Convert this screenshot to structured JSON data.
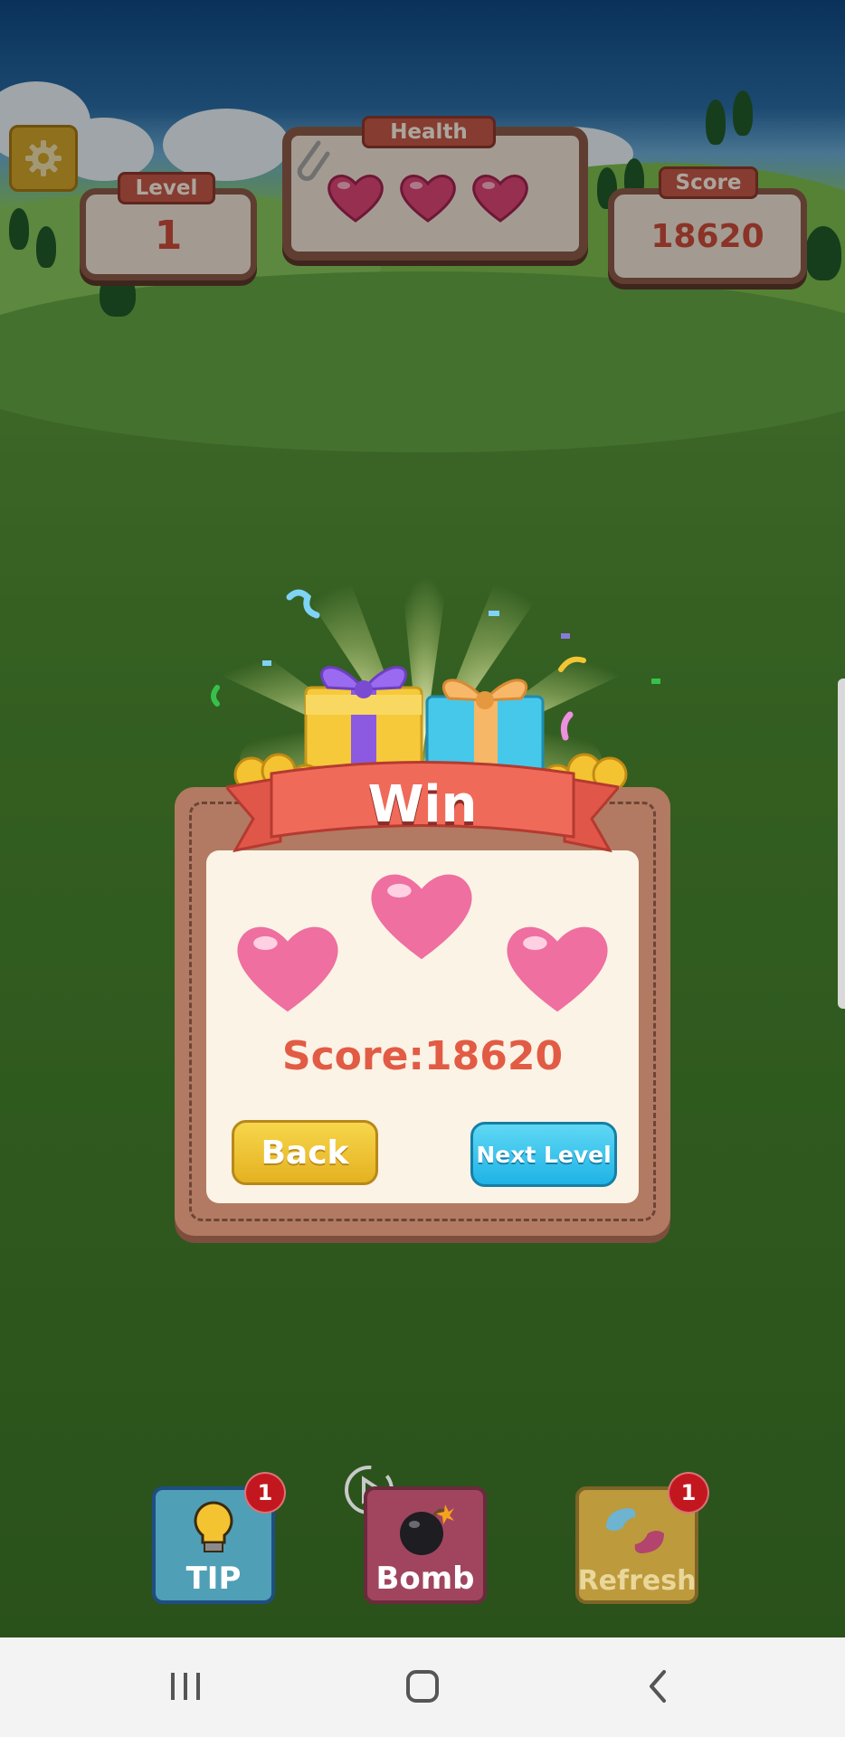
{
  "hud": {
    "level_label": "Level",
    "level_value": "1",
    "health_label": "Health",
    "health_hearts": 3,
    "score_label": "Score",
    "score_value": "18620"
  },
  "win_dialog": {
    "title": "Win",
    "stars_hearts": 3,
    "score_text": "Score:18620",
    "back_label": "Back",
    "next_label": "Next Level"
  },
  "tools": {
    "tip_label": "TIP",
    "tip_badge": "1",
    "bomb_label": "Bomb",
    "refresh_label": "Refresh",
    "refresh_badge": "1"
  },
  "colors": {
    "heart": "#e8507e",
    "score_text": "#e25b45",
    "back_button": "#f2c935",
    "next_button": "#35c3ee",
    "panel_border": "#8e5d49"
  },
  "icons": [
    "gear-icon",
    "paperclip-icon",
    "heart-icon",
    "gift-icon",
    "lightbulb-icon",
    "bomb-icon",
    "play-icon",
    "refresh-blobs-icon",
    "recent-apps-icon",
    "home-icon",
    "back-icon"
  ]
}
